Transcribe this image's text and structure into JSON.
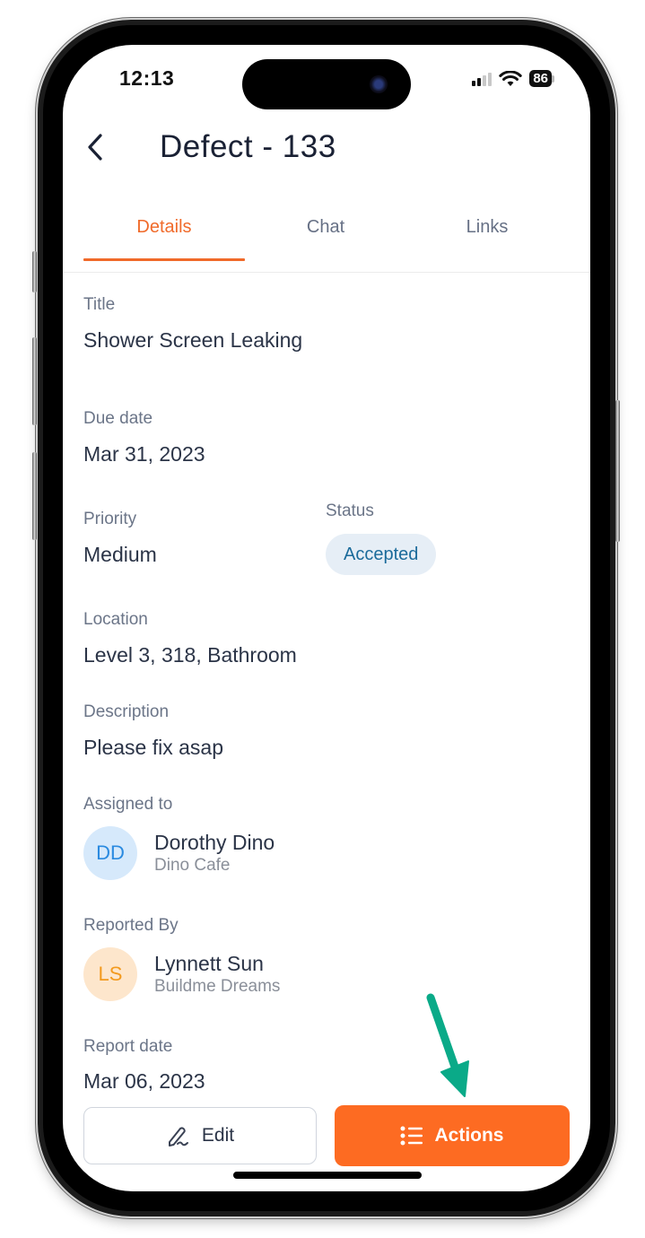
{
  "status_bar": {
    "time": "12:13",
    "battery": "86",
    "signal_bars_active": 2,
    "signal_bars_total": 4
  },
  "header": {
    "back_icon": "chevron-left-icon",
    "title": "Defect - 133"
  },
  "tabs": [
    {
      "label": "Details",
      "active": true
    },
    {
      "label": "Chat",
      "active": false
    },
    {
      "label": "Links",
      "active": false
    }
  ],
  "fields": {
    "title": {
      "label": "Title",
      "value": "Shower Screen Leaking"
    },
    "due_date": {
      "label": "Due date",
      "value": "Mar 31, 2023"
    },
    "priority": {
      "label": "Priority",
      "value": "Medium"
    },
    "status": {
      "label": "Status",
      "value": "Accepted"
    },
    "location": {
      "label": "Location",
      "value": "Level 3, 318, Bathroom"
    },
    "description": {
      "label": "Description",
      "value": "Please fix asap"
    },
    "assigned_to": {
      "label": "Assigned to",
      "initials": "DD",
      "name": "Dorothy Dino",
      "org": "Dino Cafe"
    },
    "reported_by": {
      "label": "Reported By",
      "initials": "LS",
      "name": "Lynnett Sun",
      "org": "Buildme Dreams"
    },
    "report_date": {
      "label": "Report date",
      "value": "Mar 06, 2023"
    }
  },
  "actions": {
    "edit_label": "Edit",
    "edit_icon": "pen-signature-icon",
    "actions_label": "Actions",
    "actions_icon": "list-icon"
  },
  "colors": {
    "accent": "#fd6b22",
    "tab_active": "#f06a2a",
    "status_badge_bg": "#e6eef6",
    "status_badge_text": "#1b6b9b",
    "avatar_dd_bg": "#d6e9fb",
    "avatar_dd_text": "#2a8ae0",
    "avatar_ls_bg": "#fde6cc",
    "avatar_ls_text": "#f39a1e",
    "annotation_arrow": "#0aaa88"
  }
}
